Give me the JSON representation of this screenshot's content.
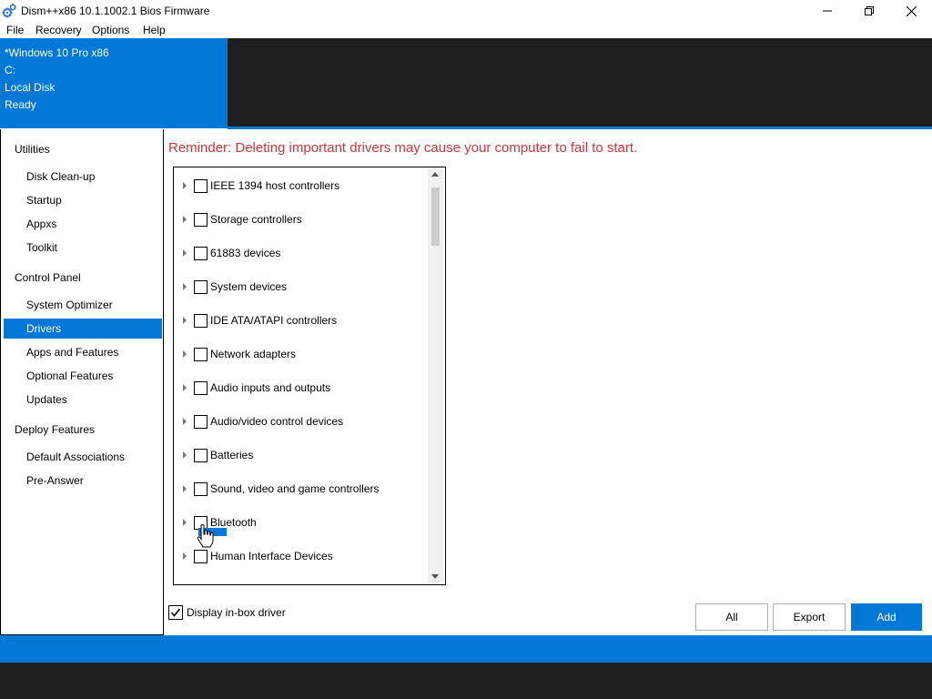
{
  "window": {
    "title": "Dism++x86 10.1.1002.1 Bios Firmware",
    "icon": "gears-icon",
    "controls": [
      "minimize-icon",
      "restore-icon",
      "close-icon"
    ]
  },
  "menu": {
    "items": [
      "File",
      "Recovery",
      "Options",
      "Help"
    ]
  },
  "header": {
    "lines": [
      "*Windows 10 Pro x86",
      "C:",
      "Local Disk",
      "Ready"
    ]
  },
  "sidebar": {
    "groups": [
      {
        "label": "Utilities",
        "items": [
          "Disk Clean-up",
          "Startup",
          "Appxs",
          "Toolkit"
        ]
      },
      {
        "label": "Control Panel",
        "items": [
          "System Optimizer",
          "Drivers",
          "Apps and Features",
          "Optional Features",
          "Updates"
        ]
      },
      {
        "label": "Deploy Features",
        "items": [
          "Default Associations",
          "Pre-Answer"
        ]
      }
    ],
    "active_item": "Drivers"
  },
  "main": {
    "reminder": "Reminder: Deleting important drivers may cause your computer to fail to start.",
    "tree_items": [
      "IEEE 1394 host controllers",
      "Storage controllers",
      "61883 devices",
      "System devices",
      "IDE ATA/ATAPI controllers",
      "Network adapters",
      "Audio inputs and outputs",
      "Audio/video control devices",
      "Batteries",
      "Sound, video and game controllers",
      "Bluetooth",
      "Human Interface Devices"
    ],
    "display_inbox": {
      "label": "Display in-box driver",
      "checked": true
    },
    "buttons": {
      "all": "All",
      "export": "Export",
      "add": "Add"
    }
  },
  "colors": {
    "accent": "#0078d7",
    "dark": "#1f1f1f",
    "reminder": "#d13438"
  }
}
